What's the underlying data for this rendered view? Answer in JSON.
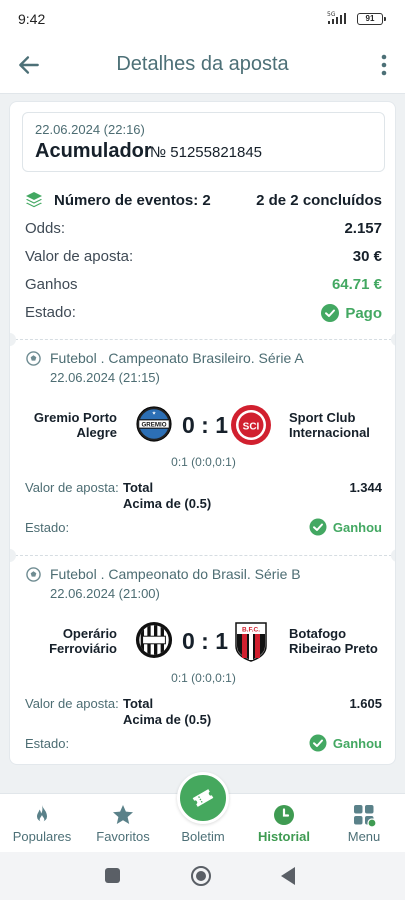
{
  "status_bar": {
    "time": "9:42",
    "network": "5G",
    "battery": "91"
  },
  "header": {
    "title": "Detalhes da aposta"
  },
  "bet": {
    "date": "22.06.2024 (22:16)",
    "type": "Acumulador",
    "number": "№ 51255821845",
    "events_label": "Número de eventos: 2",
    "events_completed": "2 de 2 concluídos",
    "odds_label": "Odds:",
    "odds_value": "2.157",
    "stake_label": "Valor de aposta:",
    "stake_value": "30 €",
    "winnings_label": "Ganhos",
    "winnings_value": "64.71 €",
    "status_label": "Estado:",
    "status_value": "Pago"
  },
  "events": [
    {
      "league": "Futebol . Campeonato Brasileiro. Série A",
      "date": "22.06.2024 (21:15)",
      "home_line1": "Gremio Porto",
      "home_line2": "Alegre",
      "away_line1": "Sport Club",
      "away_line2": "Internacional",
      "score": "0 : 1",
      "score_detail": "0:1 (0:0,0:1)",
      "stake_label": "Valor de aposta:",
      "market": "Total",
      "pick": "Acima de (0.5)",
      "odd": "1.344",
      "status_label": "Estado:",
      "status_value": "Ganhou"
    },
    {
      "league": "Futebol . Campeonato do Brasil. Série B",
      "date": "22.06.2024 (21:00)",
      "home_line1": "Operário",
      "home_line2": "Ferroviário",
      "away_line1": "Botafogo",
      "away_line2": "Ribeirao Preto",
      "score": "0 : 1",
      "score_detail": "0:1 (0:0,0:1)",
      "stake_label": "Valor de aposta:",
      "market": "Total",
      "pick": "Acima de (0.5)",
      "odd": "1.605",
      "status_label": "Estado:",
      "status_value": "Ganhou"
    }
  ],
  "logos": {
    "gremio_text": "GREMIO",
    "inter_text": "SCI",
    "botafogo_text": "B.F.C."
  },
  "bottom_nav": {
    "populares": "Populares",
    "favoritos": "Favoritos",
    "boletim": "Boletim",
    "historial": "Historial",
    "menu": "Menu"
  },
  "colors": {
    "accent_green": "#43a862",
    "title_teal": "#4d7077",
    "fab_green": "#45a85e"
  }
}
